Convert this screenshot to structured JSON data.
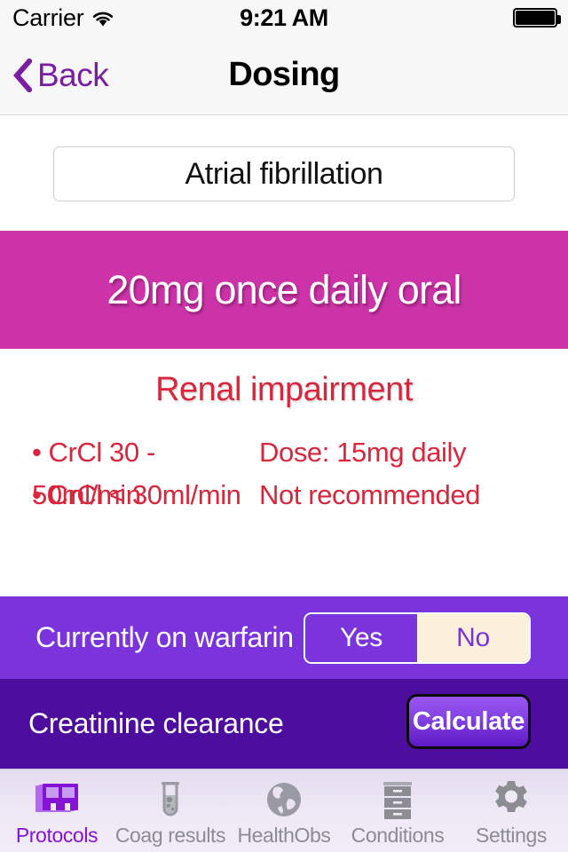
{
  "status_bar": {
    "carrier": "Carrier",
    "wifi_icon": "wifi-icon",
    "time": "9:21 AM",
    "battery_icon": "battery-full-icon"
  },
  "nav_bar": {
    "back_label": "Back",
    "back_icon": "chevron-left-icon",
    "title": "Dosing"
  },
  "condition": {
    "selected": "Atrial fibrillation"
  },
  "dose_banner": {
    "text": "20mg once daily oral",
    "background_color": "#cc33a8",
    "text_color": "#ffffff"
  },
  "renal": {
    "title": "Renal impairment",
    "title_color": "#d9263c",
    "bullet": "•",
    "rows": [
      {
        "crcl": "CrCl 30 - 50ml/min",
        "dose": "Dose: 15mg daily"
      },
      {
        "crcl": "CrCl < 30ml/min",
        "dose": "Not recommended"
      }
    ]
  },
  "warfarin": {
    "label": "Currently on warfarin",
    "background_color": "#7b34dc",
    "options": [
      {
        "label": "Yes",
        "selected": true
      },
      {
        "label": "No",
        "selected": false
      }
    ]
  },
  "creatinine": {
    "label": "Creatinine clearance",
    "background_color": "#4d0d9e",
    "button_label": "Calculate"
  },
  "tab_bar": {
    "active_color": "#8612d6",
    "inactive_color": "#8c8c93",
    "tabs": [
      {
        "label": "Protocols",
        "icon": "protocols-stack-icon",
        "active": true
      },
      {
        "label": "Coag results",
        "icon": "test-tube-icon",
        "active": false
      },
      {
        "label": "HealthObs",
        "icon": "globe-icon",
        "active": false
      },
      {
        "label": "Conditions",
        "icon": "filing-cabinet-icon",
        "active": false
      },
      {
        "label": "Settings",
        "icon": "gear-icon",
        "active": false
      }
    ]
  }
}
